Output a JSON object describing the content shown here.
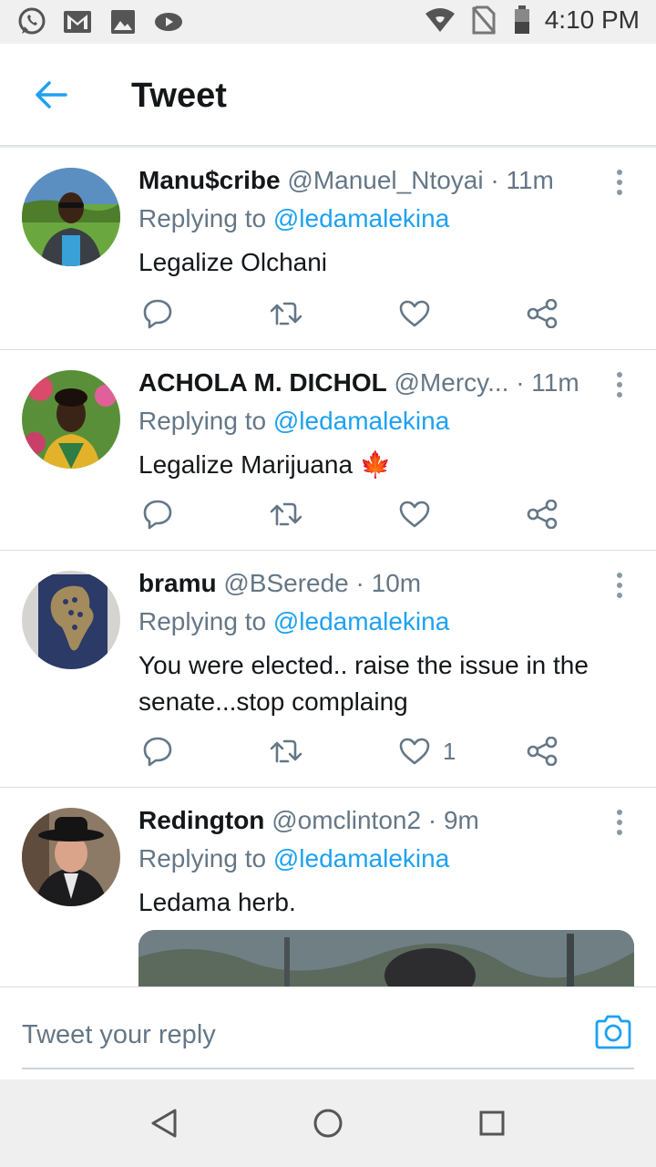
{
  "status_bar": {
    "time": "4:10 PM",
    "left_icons": [
      "whatsapp-icon",
      "gmail-icon",
      "gallery-icon",
      "cast-icon"
    ],
    "right_icons": [
      "wifi-icon",
      "no-sim-icon",
      "battery-icon"
    ]
  },
  "header": {
    "back_icon": "back-arrow-icon",
    "title": "Tweet"
  },
  "tweets": [
    {
      "name": "Manu$cribe",
      "handle": "@Manuel_Ntoyai",
      "dot": "·",
      "time": "11m",
      "replying_prefix": "Replying to ",
      "replying_to": "@ledamalekina",
      "text": "Legalize Olchani",
      "like_count": ""
    },
    {
      "name": "ACHOLA M. DICHOL",
      "handle": "@Mercy...",
      "dot": "·",
      "time": "11m",
      "replying_prefix": "Replying to ",
      "replying_to": "@ledamalekina",
      "text": "Legalize Marijuana 🍁",
      "like_count": ""
    },
    {
      "name": "bramu",
      "handle": "@BSerede",
      "dot": "·",
      "time": "10m",
      "replying_prefix": "Replying to ",
      "replying_to": "@ledamalekina",
      "text": "You were elected.. raise the issue in the senate...stop complaing",
      "like_count": "1"
    },
    {
      "name": "Redington",
      "handle": "@omclinton2",
      "dot": "·",
      "time": "9m",
      "replying_prefix": "Replying to ",
      "replying_to": "@ledamalekina",
      "text": "Ledama herb.",
      "like_count": ""
    }
  ],
  "composer": {
    "placeholder": "Tweet your reply",
    "camera_icon": "camera-icon"
  },
  "navbar": {
    "buttons": [
      "back-triangle-icon",
      "home-circle-icon",
      "recents-square-icon"
    ]
  },
  "colors": {
    "accent": "#1da1f2",
    "secondary_text": "#657786",
    "primary_text": "#14171a",
    "divider": "#d8dde1"
  }
}
